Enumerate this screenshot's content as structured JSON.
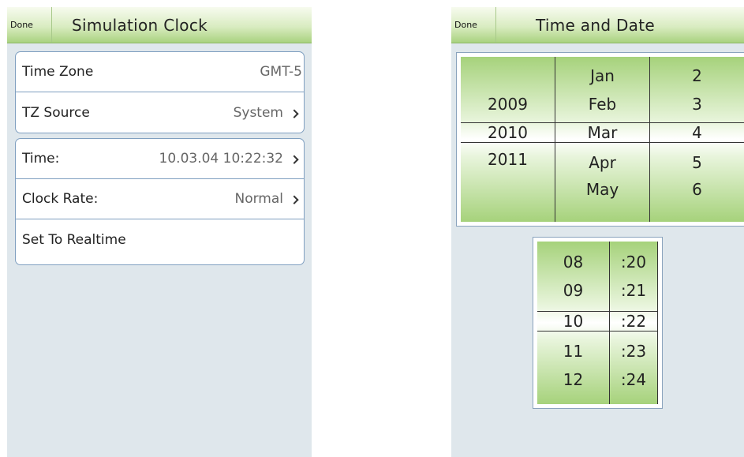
{
  "left": {
    "done_label": "Done",
    "title": "Simulation Clock",
    "group1": [
      {
        "label": "Time Zone",
        "value": "GMT-5"
      },
      {
        "label": "TZ Source",
        "value": "System"
      }
    ],
    "group2": [
      {
        "label": "Time:",
        "value": "10.03.04 10:22:32"
      },
      {
        "label": "Clock Rate:",
        "value": "Normal"
      },
      {
        "label": "Set To Realtime",
        "value": ""
      }
    ]
  },
  "right": {
    "done_label": "Done",
    "title": "Time and Date",
    "date_picker": {
      "years": [
        "",
        "2009",
        "2010",
        "2011",
        ""
      ],
      "months": [
        "Jan",
        "Feb",
        "Mar",
        "Apr",
        "May"
      ],
      "days": [
        "2",
        "3",
        "4",
        "5",
        "6"
      ],
      "selected": {
        "year": "2010",
        "month": "Mar",
        "day": "4"
      }
    },
    "time_picker": {
      "hours": [
        "08",
        "09",
        "10",
        "11",
        "12"
      ],
      "minutes": [
        ":20",
        ":21",
        ":22",
        ":23",
        ":24"
      ],
      "selected": {
        "hour": "10",
        "minute": ":22"
      }
    }
  },
  "colors": {
    "header_green": "#a9d27f",
    "panel_background": "#dfe7ec",
    "group_border": "#7f9fc0"
  }
}
